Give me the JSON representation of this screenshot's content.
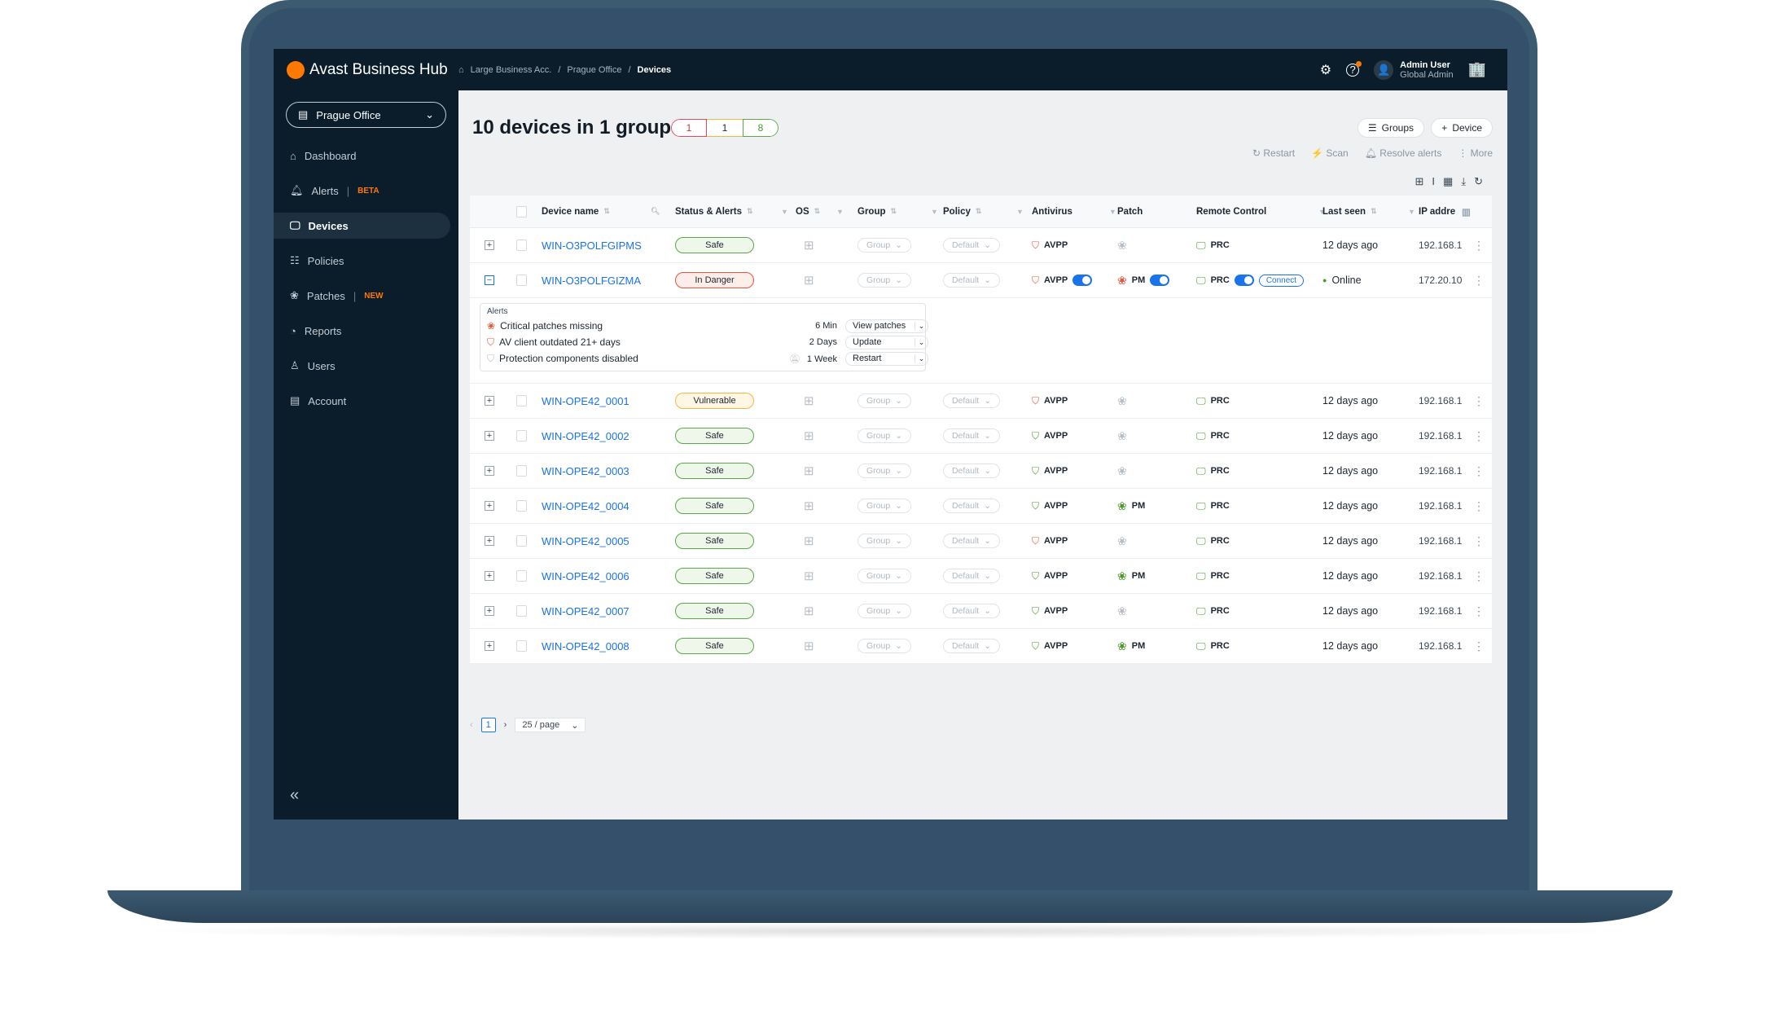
{
  "app": {
    "name": "Avast Business Hub"
  },
  "breadcrumb": [
    "Large Business Acc.",
    "Prague Office",
    "Devices"
  ],
  "user": {
    "name": "Admin User",
    "role": "Global Admin"
  },
  "sidebar": {
    "office": "Prague Office",
    "items": [
      {
        "label": "Dashboard",
        "icon": "home-icon"
      },
      {
        "label": "Alerts",
        "tag": "BETA",
        "icon": "bell-icon"
      },
      {
        "label": "Devices",
        "icon": "monitor-icon",
        "active": true
      },
      {
        "label": "Policies",
        "icon": "policies-icon"
      },
      {
        "label": "Patches",
        "tag": "NEW",
        "icon": "patch-icon"
      },
      {
        "label": "Reports",
        "icon": "pie-chart-icon"
      },
      {
        "label": "Users",
        "icon": "user-icon"
      },
      {
        "label": "Account",
        "icon": "receipt-icon"
      }
    ]
  },
  "page": {
    "title": "10 devices in 1 group",
    "counts": {
      "danger": "1",
      "vulnerable": "1",
      "safe": "8"
    },
    "groups_label": "Groups",
    "device_label": "Device",
    "actions": [
      "Restart",
      "Scan",
      "Resolve alerts",
      "More"
    ]
  },
  "table": {
    "headers": [
      "Device name",
      "Status & Alerts",
      "OS",
      "Group",
      "Policy",
      "Antivirus",
      "Patch",
      "Remote Control",
      "Last seen",
      "IP addre"
    ],
    "rows": [
      {
        "name": "WIN-O3POLFGIPMS",
        "status": "Safe",
        "group": "Group",
        "policy": "Default",
        "av": "AVPP",
        "av_state": "red",
        "patch": "",
        "patch_state": "grey",
        "rc": "PRC",
        "last_seen": "12 days ago",
        "ip": "192.168.1"
      },
      {
        "name": "WIN-O3POLFGIZMA",
        "status": "In Danger",
        "group": "Group",
        "policy": "Default",
        "av": "AVPP",
        "av_state": "red",
        "patch": "PM",
        "patch_state": "red",
        "rc": "PRC",
        "connect": "Connect",
        "last_seen": "Online",
        "ip": "172.20.10",
        "expanded": true
      },
      {
        "name": "WIN-OPE42_0001",
        "status": "Vulnerable",
        "group": "Group",
        "policy": "Default",
        "av": "AVPP",
        "av_state": "red",
        "patch": "",
        "patch_state": "grey",
        "rc": "PRC",
        "last_seen": "12 days ago",
        "ip": "192.168.1"
      },
      {
        "name": "WIN-OPE42_0002",
        "status": "Safe",
        "group": "Group",
        "policy": "Default",
        "av": "AVPP",
        "av_state": "green",
        "patch": "",
        "patch_state": "grey",
        "rc": "PRC",
        "last_seen": "12 days ago",
        "ip": "192.168.1"
      },
      {
        "name": "WIN-OPE42_0003",
        "status": "Safe",
        "group": "Group",
        "policy": "Default",
        "av": "AVPP",
        "av_state": "green",
        "patch": "",
        "patch_state": "grey",
        "rc": "PRC",
        "last_seen": "12 days ago",
        "ip": "192.168.1"
      },
      {
        "name": "WIN-OPE42_0004",
        "status": "Safe",
        "group": "Group",
        "policy": "Default",
        "av": "AVPP",
        "av_state": "green",
        "patch": "PM",
        "patch_state": "green",
        "rc": "PRC",
        "last_seen": "12 days ago",
        "ip": "192.168.1"
      },
      {
        "name": "WIN-OPE42_0005",
        "status": "Safe",
        "group": "Group",
        "policy": "Default",
        "av": "AVPP",
        "av_state": "red",
        "patch": "",
        "patch_state": "grey",
        "rc": "PRC",
        "last_seen": "12 days ago",
        "ip": "192.168.1"
      },
      {
        "name": "WIN-OPE42_0006",
        "status": "Safe",
        "group": "Group",
        "policy": "Default",
        "av": "AVPP",
        "av_state": "green",
        "patch": "PM",
        "patch_state": "green",
        "rc": "PRC",
        "last_seen": "12 days ago",
        "ip": "192.168.1"
      },
      {
        "name": "WIN-OPE42_0007",
        "status": "Safe",
        "group": "Group",
        "policy": "Default",
        "av": "AVPP",
        "av_state": "green",
        "patch": "",
        "patch_state": "grey",
        "rc": "PRC",
        "last_seen": "12 days ago",
        "ip": "192.168.1"
      },
      {
        "name": "WIN-OPE42_0008",
        "status": "Safe",
        "group": "Group",
        "policy": "Default",
        "av": "AVPP",
        "av_state": "green",
        "patch": "PM",
        "patch_state": "green",
        "rc": "PRC",
        "last_seen": "12 days ago",
        "ip": "192.168.1"
      }
    ],
    "alerts": {
      "title": "Alerts",
      "items": [
        {
          "text": "Critical patches missing",
          "time": "6 Min",
          "action": "View patches",
          "icon": "patch-icon",
          "color": "red"
        },
        {
          "text": "AV client outdated 21+ days",
          "time": "2 Days",
          "action": "Update",
          "icon": "shield-icon",
          "color": "red"
        },
        {
          "text": "Protection components disabled",
          "time": "1 Week",
          "action": "Restart",
          "icon": "shield-icon",
          "color": "grey",
          "muted": true
        }
      ]
    }
  },
  "pagination": {
    "page": "1",
    "per_page": "25 / page"
  },
  "colors": {
    "brand": "#ff7800",
    "link": "#1a73e8",
    "safe": "#5aa84a",
    "danger": "#e4553c",
    "vulnerable": "#f4b740"
  }
}
